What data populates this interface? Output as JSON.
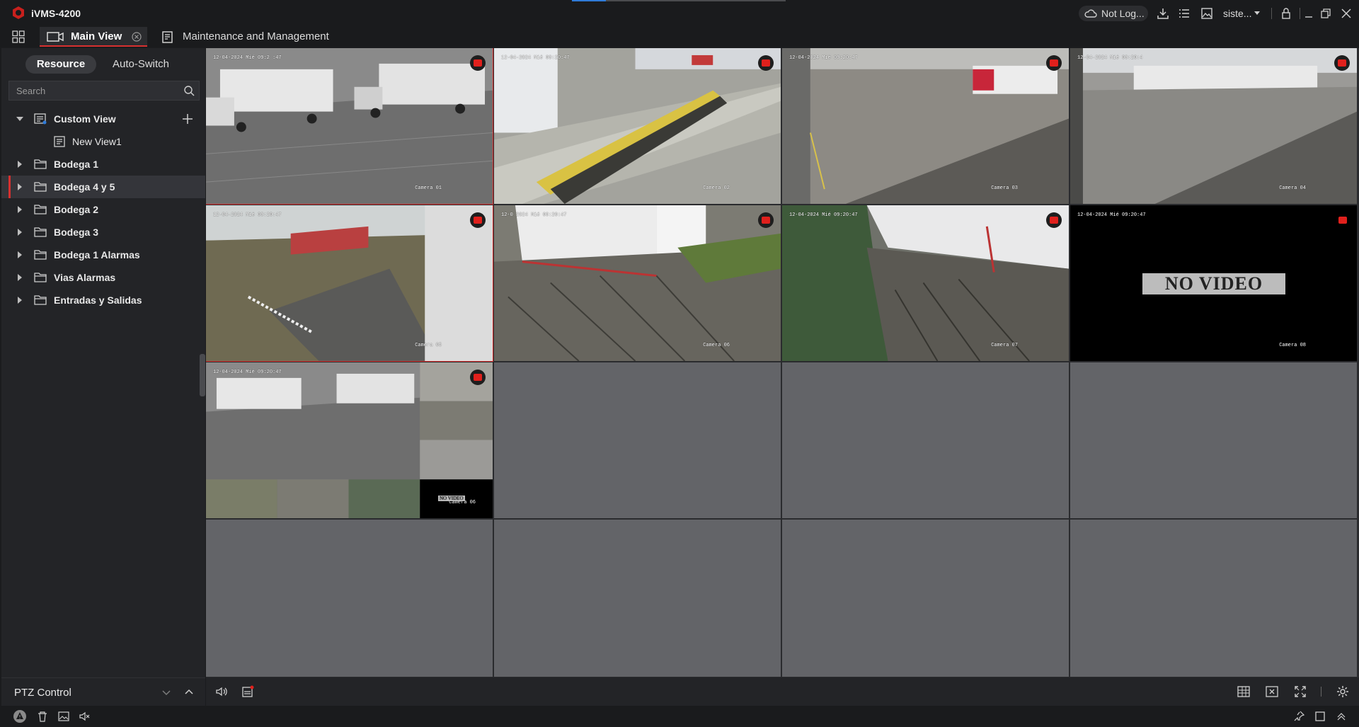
{
  "app": {
    "title": "iVMS-4200",
    "top_progress_fraction": 0.16
  },
  "topbar": {
    "cloud_label": "Not Log...",
    "user_label": "siste...",
    "icons": [
      "cloud-icon",
      "download-icon",
      "task-list-icon",
      "image-icon",
      "dropdown-icon",
      "lock-icon",
      "minimize-icon",
      "restore-icon",
      "close-icon"
    ]
  },
  "tabs": [
    {
      "label": "Main View",
      "active": true
    },
    {
      "label": "Maintenance and Management",
      "active": false
    }
  ],
  "leftpanel": {
    "segments": {
      "active": "Resource",
      "inactive": "Auto-Switch"
    },
    "search_placeholder": "Search",
    "tree": [
      {
        "label": "Custom View",
        "expanded": true,
        "type": "view-group"
      },
      {
        "label": "New View1",
        "type": "view",
        "child": true
      },
      {
        "label": "Bodega 1",
        "type": "folder"
      },
      {
        "label": "Bodega 4 y 5",
        "type": "folder",
        "selected": true
      },
      {
        "label": "Bodega 2",
        "type": "folder"
      },
      {
        "label": "Bodega 3",
        "type": "folder"
      },
      {
        "label": "Bodega 1 Alarmas",
        "type": "folder"
      },
      {
        "label": "Vias Alarmas",
        "type": "folder"
      },
      {
        "label": "Entradas y Salidas",
        "type": "folder"
      }
    ],
    "ptz_label": "PTZ Control"
  },
  "cameras": [
    {
      "ts": "12-04-2024 Mié 09:2 :47",
      "name": "Camera 01",
      "status": "video",
      "selected": true
    },
    {
      "ts": "12-04-2024 Mié 09:20:47",
      "name": "Camera 02",
      "status": "video"
    },
    {
      "ts": "12-04-2024 Mié 09:20:47",
      "name": "Camera 03",
      "status": "video"
    },
    {
      "ts": "12-04-2024 Mié 09:20:4",
      "name": "Camera 04",
      "status": "video"
    },
    {
      "ts": "12-04-2024 Mié 09:20:47",
      "name": "Camera 05",
      "status": "video",
      "selected": true
    },
    {
      "ts": "12-0 2024 Mié 09:20:47",
      "name": "Camera 06",
      "status": "video"
    },
    {
      "ts": "12-04-2024 Mié 09:20:47",
      "name": "Camera 07",
      "status": "video"
    },
    {
      "ts": "12-04-2024 Mié 09:20:47",
      "name": "Camera 08",
      "status": "novideo",
      "no_video_text": "NO VIDEO"
    },
    {
      "ts": "12-04-2024 Mié 09:20:47",
      "name": "Camera 06",
      "status": "multi",
      "no_video_text": "NO VIDEO"
    }
  ],
  "colors": {
    "accent": "#d6302f",
    "panel_bg": "#232427",
    "empty_cell": "#636468"
  }
}
